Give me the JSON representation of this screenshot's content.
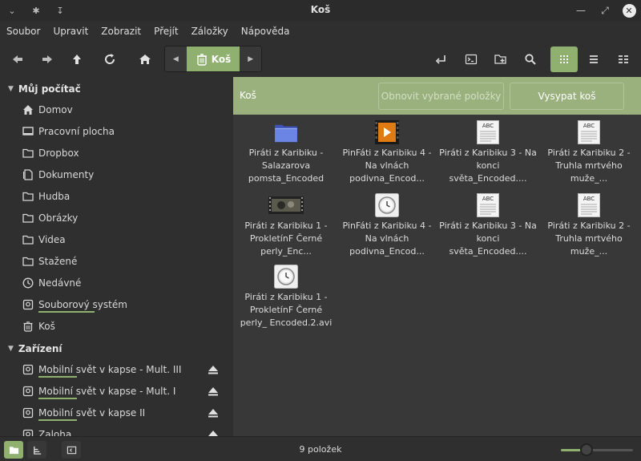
{
  "window": {
    "title": "Koš"
  },
  "menu": [
    "Soubor",
    "Upravit",
    "Zobrazit",
    "Přejít",
    "Záložky",
    "Nápověda"
  ],
  "pathbar": {
    "current": "Koš"
  },
  "sidebar": {
    "computer_header": "Můj počítač",
    "computer_items": [
      {
        "label": "Domov",
        "icon": "home-icon"
      },
      {
        "label": "Pracovní plocha",
        "icon": "desktop-icon"
      },
      {
        "label": "Dropbox",
        "icon": "folder-icon"
      },
      {
        "label": "Dokumenty",
        "icon": "documents-icon"
      },
      {
        "label": "Hudba",
        "icon": "folder-icon"
      },
      {
        "label": "Obrázky",
        "icon": "folder-icon"
      },
      {
        "label": "Videa",
        "icon": "folder-icon"
      },
      {
        "label": "Stažené",
        "icon": "folder-icon"
      },
      {
        "label": "Nedávné",
        "icon": "clock-icon"
      },
      {
        "label": "Souborový systém",
        "icon": "drive-icon",
        "usage": 0.8
      },
      {
        "label": "Koš",
        "icon": "trash-icon"
      }
    ],
    "devices_header": "Zařízení",
    "device_items": [
      {
        "label": "Mobilní svět v kapse - Mult. III",
        "usage": 0.45
      },
      {
        "label": "Mobilní svět v kapse - Mult. I",
        "usage": 0.45
      },
      {
        "label": "Mobilní svět v kapse II",
        "usage": 0.45
      },
      {
        "label": "Zaloha",
        "usage": 0.5
      }
    ]
  },
  "trashbar": {
    "label": "Koš",
    "restore_label": "Obnovit vybrané položky",
    "empty_label": "Vysypat koš"
  },
  "files": [
    {
      "name": "Piráti z Karibiku - Salazarova pomsta_Encoded",
      "type": "folder"
    },
    {
      "name": "PinFáti z Karibiku 4 - Na vlnách podivna_Encod...",
      "type": "video-thumb"
    },
    {
      "name": "Piráti z Karibiku 3 - Na konci světa_Encoded....",
      "type": "text"
    },
    {
      "name": "Piráti z Karibiku 2 - Truhla mrtvého muže_...",
      "type": "text"
    },
    {
      "name": "Piráti z Karibiku 1 - ProkletínF Černé perly_Enc...",
      "type": "film-thumb"
    },
    {
      "name": "PinFáti z Karibiku 4 - Na vlnách podivna_Encod...",
      "type": "clock"
    },
    {
      "name": "Piráti z Karibiku 3 - Na konci světa_Encoded....",
      "type": "text"
    },
    {
      "name": "Piráti z Karibiku 2 - Truhla mrtvého muže_...",
      "type": "text"
    },
    {
      "name": "Piráti z Karibiku 1 - ProkletínF Černé perly_ Encoded.2.avi",
      "type": "clock"
    }
  ],
  "status": {
    "text": "9 položek",
    "zoom": 0.35
  },
  "colors": {
    "accent": "#8fb06e",
    "trashbar": "#9ab17e"
  }
}
